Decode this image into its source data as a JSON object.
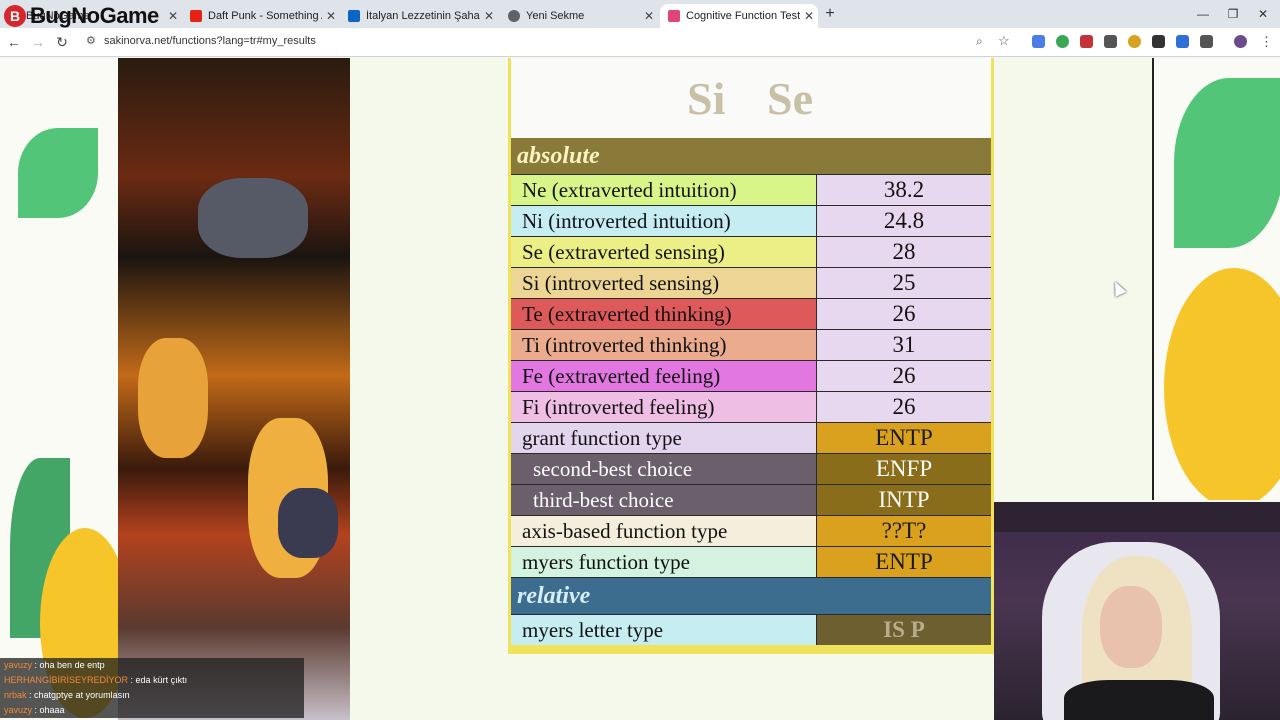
{
  "browser": {
    "tabs": [
      {
        "title": "BugNoGame",
        "favicon_color": "#d6252b",
        "active": false
      },
      {
        "title": "Daft Punk - Something About Us",
        "favicon_color": "#e62117",
        "active": false
      },
      {
        "title": "İtalyan Lezzetinin Şahanesi Tiramisu",
        "favicon_color": "#0a66c2",
        "active": false
      },
      {
        "title": "Yeni Sekme",
        "favicon_color": "#5f6368",
        "active": false
      },
      {
        "title": "Cognitive Function Test (Grant/Beebe)",
        "favicon_color": "#e0447a",
        "active": true
      }
    ],
    "url": "sakinorva.net/functions?lang=tr#my_results"
  },
  "overlay": {
    "logo_text": "BugNoGame",
    "chat": [
      {
        "user": "yavuzy",
        "message": ": oha ben de entp"
      },
      {
        "user": "HERHANGİBİRİSEYREDİYOR",
        "message": ": eda kürt çıktı"
      },
      {
        "user": "nrbak",
        "message": ": chatgptye at yorumlasın"
      },
      {
        "user": "yavuzy",
        "message": ": ohaaa"
      }
    ]
  },
  "results": {
    "top_letters": [
      "Si",
      "Se"
    ],
    "absolute_heading": "absolute",
    "relative_heading": "relative",
    "functions": [
      {
        "label": "Ne (extraverted intuition)",
        "value": "38.2",
        "color": "#d8f58a"
      },
      {
        "label": "Ni (introverted intuition)",
        "value": "24.8",
        "color": "#c6eef2"
      },
      {
        "label": "Se (extraverted sensing)",
        "value": "28",
        "color": "#ecef86"
      },
      {
        "label": "Si (introverted sensing)",
        "value": "25",
        "color": "#edd695"
      },
      {
        "label": "Te (extraverted thinking)",
        "value": "26",
        "color": "#de5a5a"
      },
      {
        "label": "Ti (introverted thinking)",
        "value": "31",
        "color": "#ebab8f"
      },
      {
        "label": "Fe (extraverted feeling)",
        "value": "26",
        "color": "#e277e2"
      },
      {
        "label": "Fi (introverted feeling)",
        "value": "26",
        "color": "#efbee5"
      }
    ],
    "types": {
      "grant_label": "grant function type",
      "grant_value": "ENTP",
      "second_label": "second-best choice",
      "second_value": "ENFP",
      "third_label": "third-best choice",
      "third_value": "INTP",
      "axis_label": "axis-based function type",
      "axis_value": "??T?",
      "myers_label": "myers function type",
      "myers_value": "ENTP"
    },
    "relative": {
      "myers_letter_label": "myers letter type",
      "myers_letter_value": "IS P"
    }
  }
}
